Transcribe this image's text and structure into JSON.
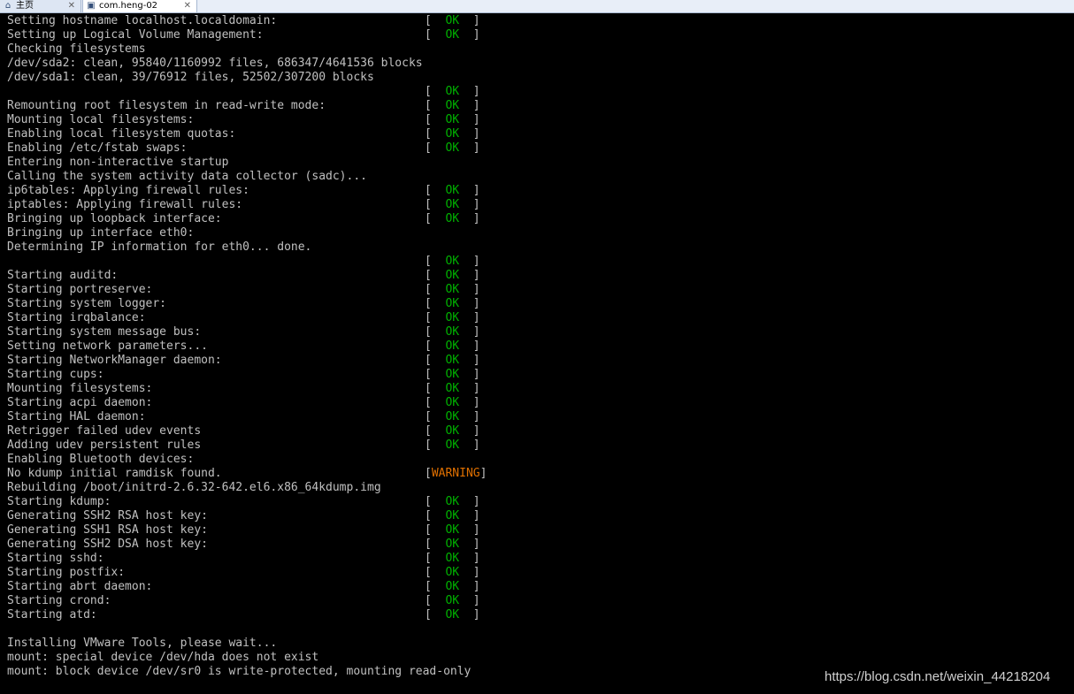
{
  "tabs": [
    {
      "label": "主页",
      "icon": "home-icon",
      "close": "✕"
    },
    {
      "label": "com.heng-02",
      "icon": "vm-icon",
      "close": "✕"
    }
  ],
  "console": {
    "lines": [
      {
        "text": "Setting hostname localhost.localdomain:",
        "status": "OK"
      },
      {
        "text": "Setting up Logical Volume Management:",
        "status": "OK"
      },
      {
        "text": "Checking filesystems",
        "status": null
      },
      {
        "text": "/dev/sda2: clean, 95840/1160992 files, 686347/4641536 blocks",
        "status": null
      },
      {
        "text": "/dev/sda1: clean, 39/76912 files, 52502/307200 blocks",
        "status": null
      },
      {
        "text": "",
        "status": "OK"
      },
      {
        "text": "Remounting root filesystem in read-write mode:",
        "status": "OK"
      },
      {
        "text": "Mounting local filesystems:",
        "status": "OK"
      },
      {
        "text": "Enabling local filesystem quotas:",
        "status": "OK"
      },
      {
        "text": "Enabling /etc/fstab swaps:",
        "status": "OK"
      },
      {
        "text": "Entering non-interactive startup",
        "status": null
      },
      {
        "text": "Calling the system activity data collector (sadc)...",
        "status": null
      },
      {
        "text": "ip6tables: Applying firewall rules:",
        "status": "OK"
      },
      {
        "text": "iptables: Applying firewall rules:",
        "status": "OK"
      },
      {
        "text": "Bringing up loopback interface:",
        "status": "OK"
      },
      {
        "text": "Bringing up interface eth0:",
        "status": null
      },
      {
        "text": "Determining IP information for eth0... done.",
        "status": null
      },
      {
        "text": "",
        "status": "OK"
      },
      {
        "text": "Starting auditd:",
        "status": "OK"
      },
      {
        "text": "Starting portreserve:",
        "status": "OK"
      },
      {
        "text": "Starting system logger:",
        "status": "OK"
      },
      {
        "text": "Starting irqbalance:",
        "status": "OK"
      },
      {
        "text": "Starting system message bus:",
        "status": "OK"
      },
      {
        "text": "Setting network parameters...",
        "status": "OK"
      },
      {
        "text": "Starting NetworkManager daemon:",
        "status": "OK"
      },
      {
        "text": "Starting cups:",
        "status": "OK"
      },
      {
        "text": "Mounting filesystems:",
        "status": "OK"
      },
      {
        "text": "Starting acpi daemon:",
        "status": "OK"
      },
      {
        "text": "Starting HAL daemon:",
        "status": "OK"
      },
      {
        "text": "Retrigger failed udev events",
        "status": "OK"
      },
      {
        "text": "Adding udev persistent rules",
        "status": "OK"
      },
      {
        "text": "Enabling Bluetooth devices:",
        "status": null
      },
      {
        "text": "No kdump initial ramdisk found.",
        "status": "WARNING"
      },
      {
        "text": "Rebuilding /boot/initrd-2.6.32-642.el6.x86_64kdump.img",
        "status": null
      },
      {
        "text": "Starting kdump:",
        "status": "OK"
      },
      {
        "text": "Generating SSH2 RSA host key:",
        "status": "OK"
      },
      {
        "text": "Generating SSH1 RSA host key:",
        "status": "OK"
      },
      {
        "text": "Generating SSH2 DSA host key:",
        "status": "OK"
      },
      {
        "text": "Starting sshd:",
        "status": "OK"
      },
      {
        "text": "Starting postfix:",
        "status": "OK"
      },
      {
        "text": "Starting abrt daemon:",
        "status": "OK"
      },
      {
        "text": "Starting crond:",
        "status": "OK"
      },
      {
        "text": "Starting atd:",
        "status": "OK"
      },
      {
        "text": "",
        "status": null
      },
      {
        "text": "Installing VMware Tools, please wait...",
        "status": null
      },
      {
        "text": "mount: special device /dev/hda does not exist",
        "status": null
      },
      {
        "text": "mount: block device /dev/sr0 is write-protected, mounting read-only",
        "status": null
      }
    ]
  },
  "watermark": "https://blog.csdn.net/weixin_44218204",
  "colors": {
    "background": "#000000",
    "text": "#c0c0c0",
    "ok": "#00b000",
    "warning": "#e07000"
  }
}
